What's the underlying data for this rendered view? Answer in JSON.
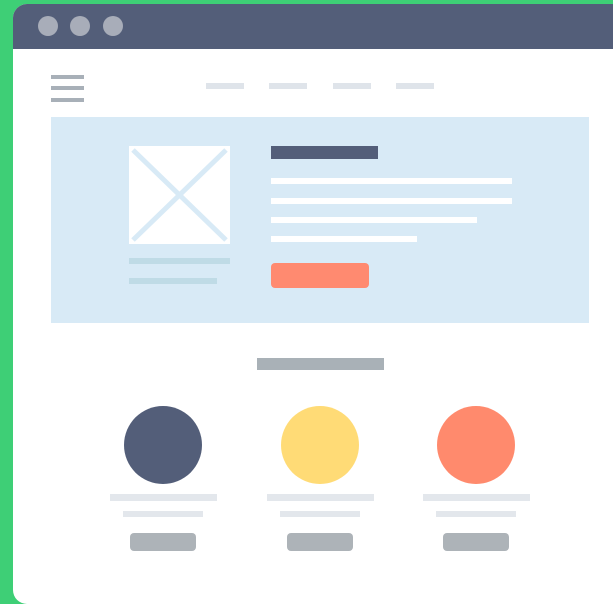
{
  "colors": {
    "background": "#3ecf76",
    "window": "#ffffff",
    "titlebar": "#535e79",
    "titlebar_dots": "#a8adb9",
    "hero_background": "#d8eaf6",
    "hero_heading": "#535e79",
    "cta_button": "#ff8a70",
    "placeholder_gray": "#a9b1b7",
    "placeholder_light": "#e3e7ec"
  },
  "window": {
    "controls": [
      "window-dot-icon",
      "window-dot-icon",
      "window-dot-icon"
    ]
  },
  "header": {
    "menu_icon": "hamburger-menu-icon",
    "nav_links": [
      "placeholder",
      "placeholder",
      "placeholder",
      "placeholder"
    ]
  },
  "hero": {
    "image_icon": "image-placeholder-icon",
    "cta_color": "#ff8a70"
  },
  "features": {
    "items": [
      {
        "circle_color": "#535e79"
      },
      {
        "circle_color": "#ffdb76"
      },
      {
        "circle_color": "#ff8a6d"
      }
    ]
  }
}
